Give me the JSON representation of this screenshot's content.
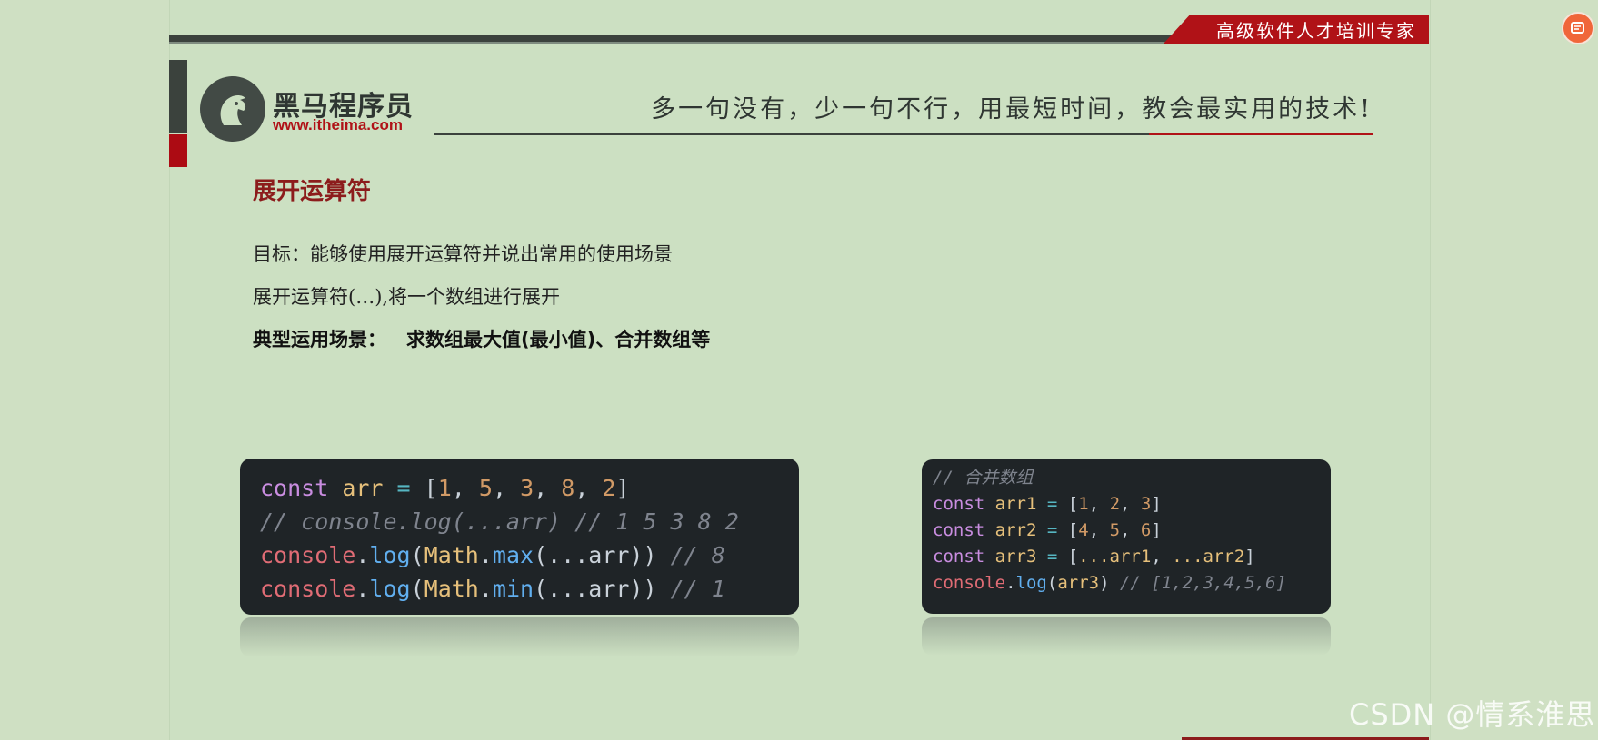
{
  "header": {
    "banner_text": "高级软件人才培训专家",
    "logo_title": "黑马程序员",
    "logo_url": "www.itheima.com",
    "slogan": "多一句没有，少一句不行，用最短时间，教会最实用的技术!"
  },
  "content": {
    "heading": "展开运算符",
    "goal": "目标：能够使用展开运算符并说出常用的使用场景",
    "description": "展开运算符(…),将一个数组进行展开",
    "scenario_label": "典型运用场景：",
    "scenario_text": "求数组最大值(最小值)、合并数组等"
  },
  "code_block_1": {
    "line1": {
      "kw": "const",
      "name": "arr",
      "op": "=",
      "open": "[",
      "n1": "1",
      "n2": "5",
      "n3": "3",
      "n4": "8",
      "n5": "2",
      "close": "]"
    },
    "line2": "// console.log(...arr) // 1 5 3 8 2",
    "line3": {
      "obj": "console",
      "method": "log",
      "math": "Math",
      "fn": "max",
      "args": "(...arr))",
      "comment": "// 8"
    },
    "line4": {
      "obj": "console",
      "method": "log",
      "math": "Math",
      "fn": "min",
      "args": "(...arr))",
      "comment": "// 1"
    }
  },
  "code_block_2": {
    "comment": "// 合并数组",
    "line1": {
      "kw": "const",
      "name": "arr1",
      "vals": [
        "1",
        "2",
        "3"
      ]
    },
    "line2": {
      "kw": "const",
      "name": "arr2",
      "vals": [
        "4",
        "5",
        "6"
      ]
    },
    "line3": {
      "kw": "const",
      "name": "arr3",
      "spread1": "...arr1",
      "spread2": "...arr2"
    },
    "line4": {
      "obj": "console",
      "method": "log",
      "arg": "arr3",
      "comment": "// [1,2,3,4,5,6]"
    }
  },
  "watermark": "CSDN @情系淮思",
  "colors": {
    "accent_red": "#b01217",
    "background": "#cce0c2",
    "code_bg": "#1f2427"
  },
  "icons": {
    "fab": "chat-edit-icon",
    "logo": "horse-head-icon"
  }
}
